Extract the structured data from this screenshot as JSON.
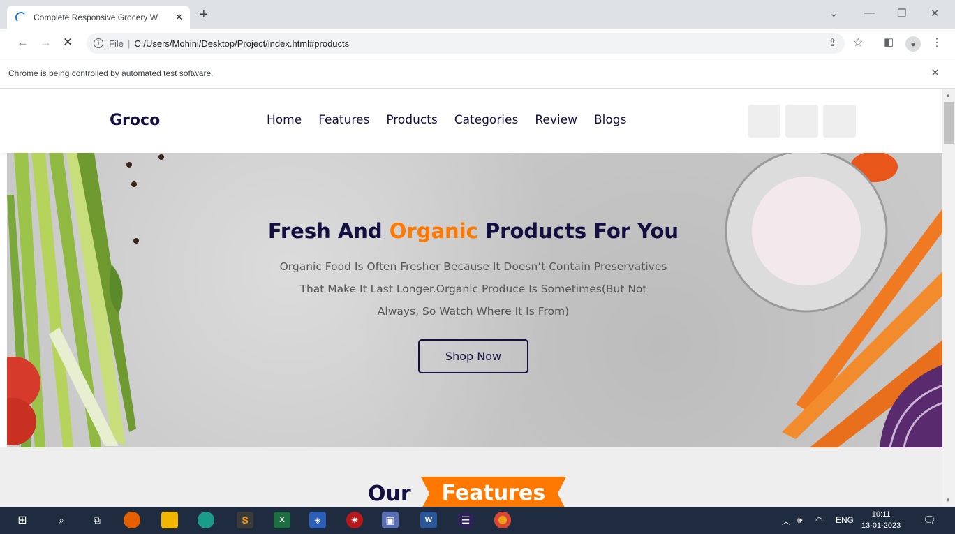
{
  "browser": {
    "tab_title": "Complete Responsive Grocery W",
    "new_tab_symbol": "+",
    "url_file_label": "File",
    "url_path": "C:/Users/Mohini/Desktop/Project/index.html#products",
    "infobar_text": "Chrome is being controlled by automated test software."
  },
  "site": {
    "logo": "Groco",
    "nav": [
      "Home",
      "Features",
      "Products",
      "Categories",
      "Review",
      "Blogs"
    ],
    "hero": {
      "title_before": "Fresh And ",
      "title_accent": "Organic",
      "title_after": " Products For You",
      "description_line1": "Organic Food Is Often Fresher Because It Doesn’t Contain Preservatives",
      "description_line2": "That Make It Last Longer.Organic Produce Is Sometimes(But Not",
      "description_line3": "Always, So Watch Where It Is From)",
      "button": "Shop Now"
    },
    "features_heading": {
      "dark": "Our",
      "accent": "Features"
    }
  },
  "taskbar": {
    "language": "ENG",
    "time": "10:11",
    "date": "13-01-2023"
  },
  "colors": {
    "brand_dark": "#130f40",
    "accent": "#ff7800"
  }
}
